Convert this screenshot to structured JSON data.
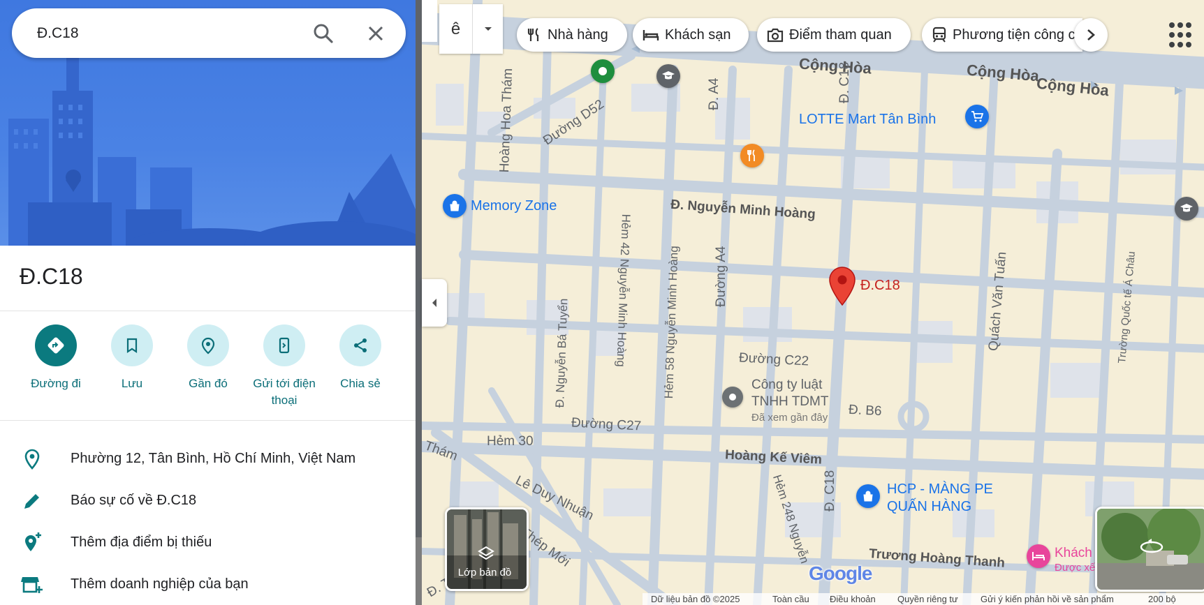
{
  "search": {
    "value": "Đ.C18"
  },
  "place": {
    "title": "Đ.C18"
  },
  "actions": [
    {
      "label": "Đường đi"
    },
    {
      "label": "Lưu"
    },
    {
      "label": "Gần đó"
    },
    {
      "label": "Gửi tới điện thoại"
    },
    {
      "label": "Chia sẻ"
    }
  ],
  "info": {
    "address": "Phường 12, Tân Bình, Hồ Chí Minh, Việt Nam",
    "report": "Báo sự cố về Đ.C18",
    "add_place": "Thêm địa điểm bị thiếu",
    "add_business": "Thêm doanh nghiệp của bạn"
  },
  "map": {
    "chips": [
      "Nhà hàng",
      "Khách sạn",
      "Điểm tham quan",
      "Phương tiện công cộng"
    ],
    "tilt_label": "ê",
    "pin_label": "Đ.C18",
    "labels": {
      "cong_hoa_1": "Cộng Hòa",
      "cong_hoa_2": "Cộng Hòa",
      "cong_hoa_3": "Cộng Hòa",
      "c18_top": "Đ. C18",
      "c18_bottom": "Đ. C18",
      "a4_top": "Đ. A4",
      "a4_mid": "Đường A4",
      "d52": "Đường D52",
      "hoang_hoa_tham": "Hoàng Hoa Thám",
      "nguyen_minh_hoang": "Đ. Nguyễn Minh Hoàng",
      "hem42": "Hẻm 42 Nguyễn Minh Hoàng",
      "hem58": "Hẻm 58 Nguyễn Minh Hoàng",
      "nguyen_ba_tuyen": "Đ. Nguyễn Bá Tuyển",
      "quach_van_tuan": "Quách Văn Tuấn",
      "truong_quoc_te": "Trường Quốc tế Á Châu",
      "c22": "Đường C22",
      "b6": "Đ. B6",
      "c27": "Đường C27",
      "hem30": "Hẻm 30",
      "tham": "Thám",
      "hoang_ke_viem": "Hoàng Kế Viêm",
      "le_duy_nhuan": "Lê Duy Nhuận",
      "thep_moi": "Thép Mới",
      "hem248": "Hẻm 248 Nguyễn",
      "truong_hoang_thanh": "Trương Hoàng Thanh",
      "truong_bl": "Đ. Trường"
    },
    "pois": {
      "memory_zone": "Memory Zone",
      "lotte": "LOTTE Mart Tân Bình",
      "cong_ty_1": "Công ty luật",
      "cong_ty_2": "TNHH TDMT",
      "da_xem": "Đã xem gần đây",
      "hcp_1": "HCP - MÀNG PE",
      "hcp_2": "QUẤN HÀNG",
      "khach": "Khách",
      "duoc_xe": "Được xế"
    },
    "layers_label": "Lớp bản đồ",
    "google": "Google",
    "footer": [
      "Dữ liệu bản đồ ©2025",
      "Toàn cầu",
      "Điều khoản",
      "Quyền riêng tư",
      "Gửi ý kiến phản hồi về sản phẩm",
      "200 bộ"
    ]
  },
  "colors": {
    "accent": "#0b7a7f",
    "accent_light": "#cfeef3",
    "pin": "#ea4335",
    "poi_blue": "#1a73e8"
  }
}
